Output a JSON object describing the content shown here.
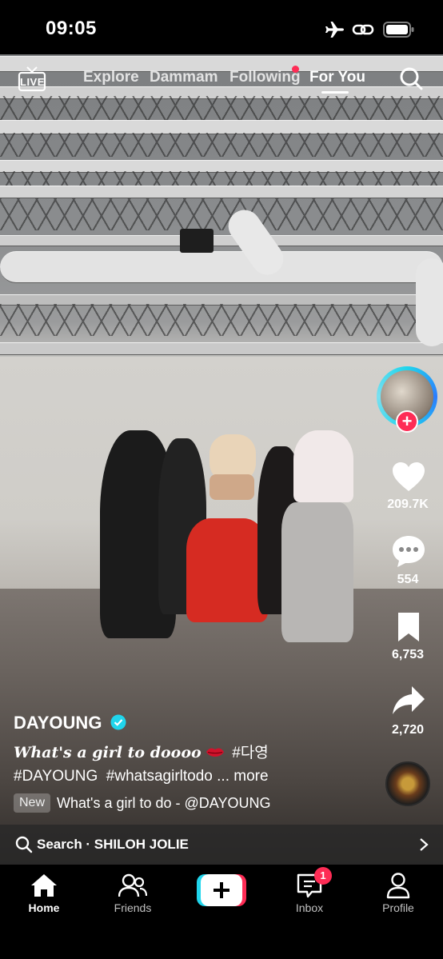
{
  "status_bar": {
    "time": "09:05"
  },
  "top_nav": {
    "live_label": "LIVE",
    "tabs": [
      {
        "label": "Explore"
      },
      {
        "label": "Dammam"
      },
      {
        "label": "Following"
      },
      {
        "label": "For You"
      }
    ],
    "active_tab": "For You"
  },
  "post": {
    "username": "DAYOUNG",
    "caption_main": "What's a girl to doooo",
    "caption_tag": "#다영",
    "hashtags": "#DAYOUNG  #whatsagirltodo",
    "more_label": "... more",
    "new_badge": "New",
    "music": "What's a girl to do - @DAYOUNG"
  },
  "actions": {
    "likes": "209.7K",
    "comments": "554",
    "saves": "6,753",
    "shares": "2,720"
  },
  "search_bar": {
    "text": "Search · SHILOH JOLIE"
  },
  "bottom_nav": {
    "home": "Home",
    "friends": "Friends",
    "inbox": "Inbox",
    "inbox_badge": "1",
    "profile": "Profile"
  },
  "colors": {
    "accent": "#fe2c55",
    "verified": "#20d5ec",
    "following_dot": "#fe2c55"
  }
}
